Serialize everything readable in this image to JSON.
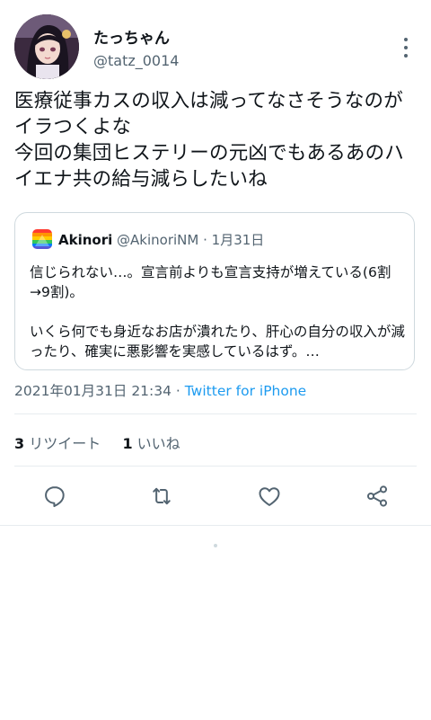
{
  "author": {
    "name": "たっちゃん",
    "handle": "@tatz_0014"
  },
  "tweet": {
    "text": "医療従事カスの収入は減ってなさそうなのがイラつくよな\n今回の集団ヒステリーの元凶でもあるあのハイエナ共の給与減らしたいね"
  },
  "quoted_tweet": {
    "name": "Akinori",
    "handle": "@AkinoriNM",
    "separator": "·",
    "date": "1月31日",
    "text": "信じられない…。宣言前よりも宣言支持が増えている(6割→9割)。\n\nいくら何でも身近なお店が潰れたり、肝心の自分の収入が減ったり、確実に悪影響を実感しているはず。…"
  },
  "meta": {
    "timestamp": "2021年01月31日 21:34",
    "separator": " · ",
    "client": "Twitter for iPhone"
  },
  "stats": {
    "retweets_count": "3",
    "retweets_label": "リツイート",
    "likes_count": "1",
    "likes_label": "いいね"
  },
  "icons": {
    "reply": "reply-icon",
    "retweet": "retweet-icon",
    "like": "heart-icon",
    "share": "share-icon",
    "more": "more-icon"
  },
  "colors": {
    "link": "#1d9bf0",
    "secondary": "#536471",
    "primary_text": "#0f1419"
  }
}
